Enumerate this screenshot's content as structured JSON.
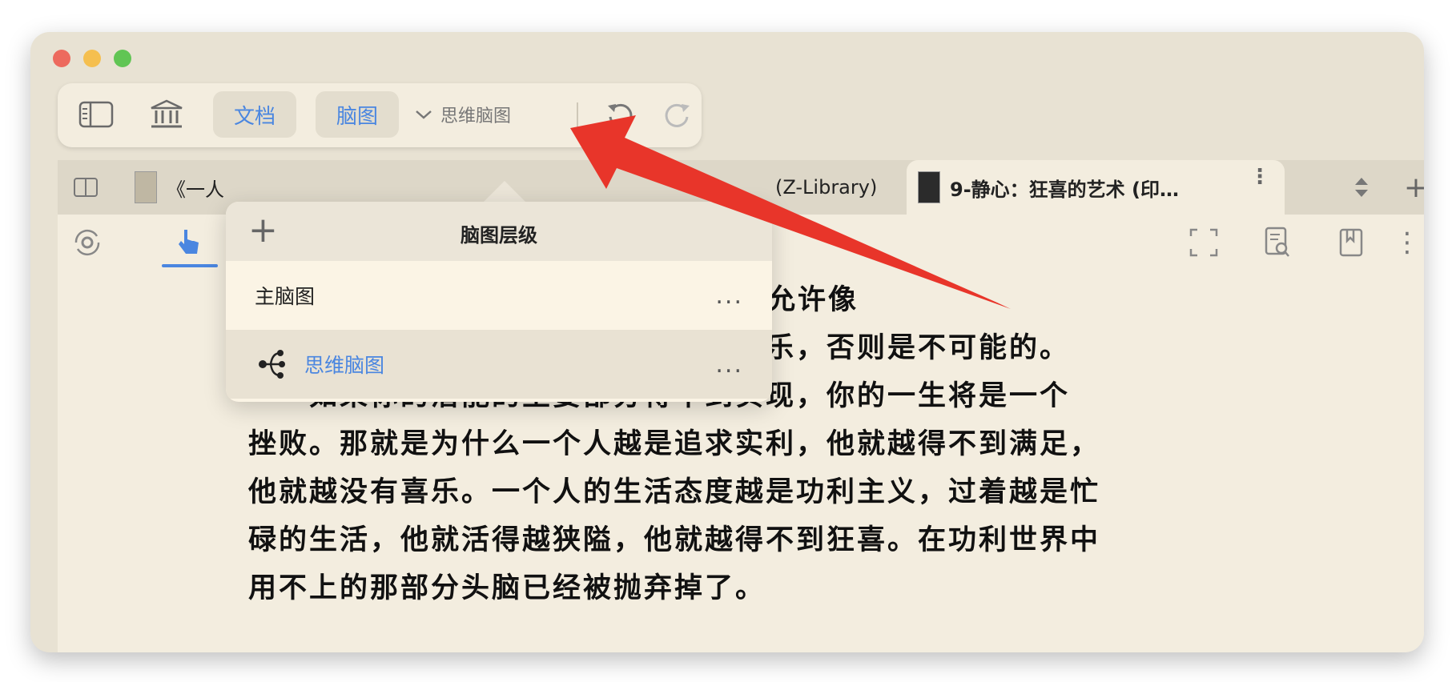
{
  "toolbar": {
    "doc_label": "文档",
    "mindmap_label": "脑图",
    "dropdown_label": "思维脑图"
  },
  "tabs": [
    {
      "label": "《一人"
    },
    {
      "label": "(Z-Library)"
    },
    {
      "label": "9-静心：狂喜的艺术 (印…"
    }
  ],
  "popover": {
    "title": "脑图层级",
    "items": [
      {
        "label": "主脑图"
      },
      {
        "label": "思维脑图"
      }
    ],
    "more_label": "..."
  },
  "page": {
    "lines": [
      "只有当潜力、无意识被允许像",
      "花一样开放时，你才能体会到存在的极乐，否则是不可能的。",
      "如果你的潜能的主要部分得不到实现，你的一生将是一个",
      "挫败。那就是为什么一个人越是追求实利，他就越得不到满足，",
      "他就越没有喜乐。一个人的生活态度越是功利主义，过着越是忙",
      "碌的生活，他就活得越狭隘，他就越得不到狂喜。在功利世界中",
      "用不上的那部分头脑已经被抛弃掉了。"
    ]
  },
  "colors": {
    "accent": "#4a86e0",
    "annotation_arrow": "#e8352a",
    "background": "#f3eddf"
  }
}
